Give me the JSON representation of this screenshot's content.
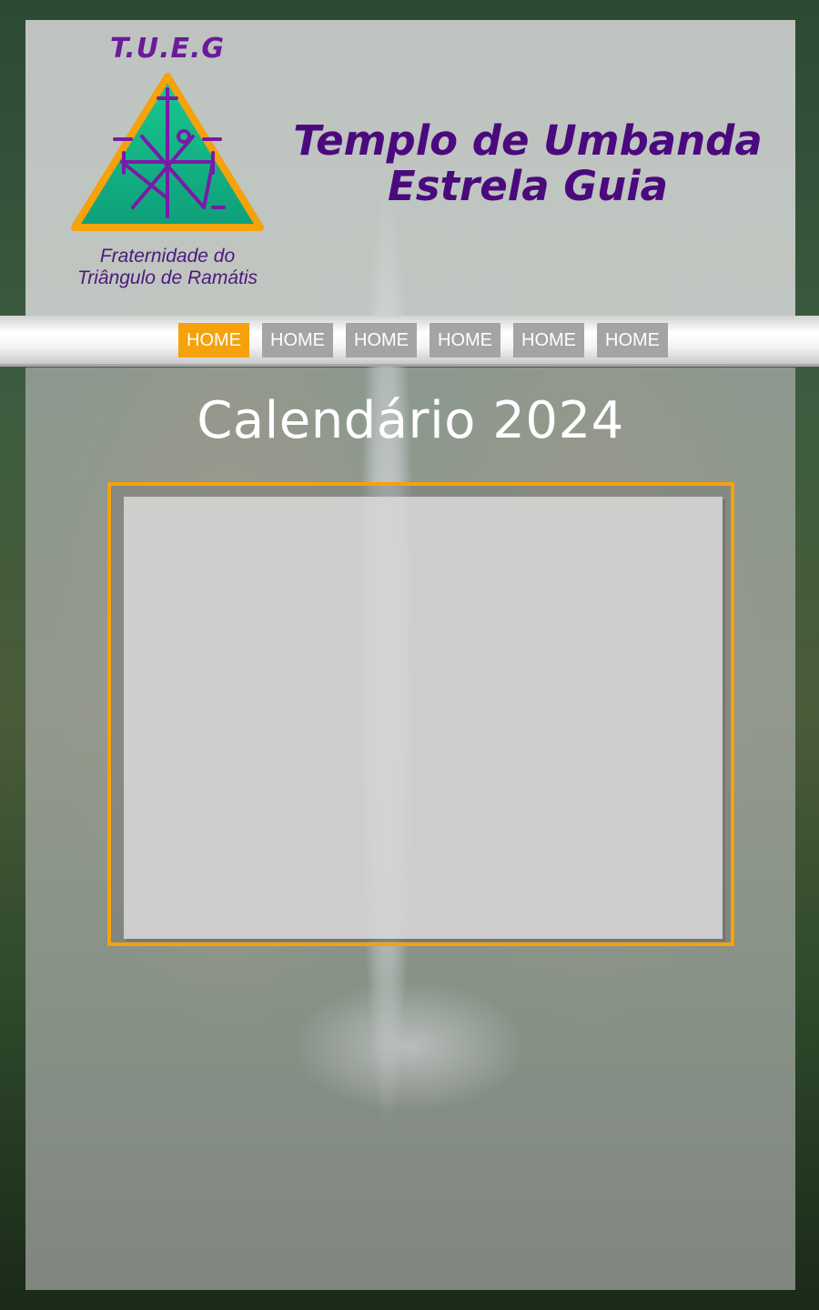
{
  "brand": {
    "abbreviation": "T.U.E.G",
    "subtitle_line1": "Fraternidade do",
    "subtitle_line2": "Triângulo de Ramátis",
    "title_line1": "Templo de Umbanda",
    "title_line2": "Estrela Guia"
  },
  "nav": {
    "items": [
      {
        "label": "HOME",
        "active": true
      },
      {
        "label": "HOME",
        "active": false
      },
      {
        "label": "HOME",
        "active": false
      },
      {
        "label": "HOME",
        "active": false
      },
      {
        "label": "HOME",
        "active": false
      },
      {
        "label": "HOME",
        "active": false
      }
    ]
  },
  "main": {
    "heading": "Calendário 2024"
  },
  "colors": {
    "accent_orange": "#f5a20b",
    "brand_purple": "#4a0a7d",
    "logo_green": "#10b58a",
    "nav_inactive": "#a4a4a4"
  },
  "icons": {
    "logo": "triangle-star-emblem"
  }
}
